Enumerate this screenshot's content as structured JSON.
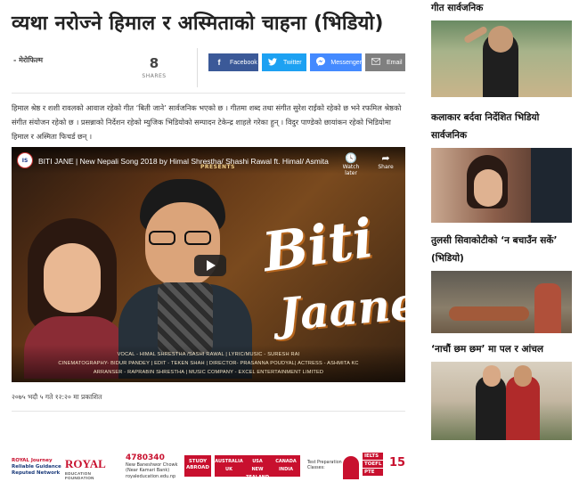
{
  "article": {
    "title": "व्यथा नरोज्ने हिमाल र अस्मिताको चाहना (भिडियो)",
    "author": "- मेरोफिल्म",
    "shares_count": "8",
    "shares_label": "SHARES",
    "share_buttons": {
      "facebook": "Facebook",
      "twitter": "Twitter",
      "messenger": "Messenger",
      "email": "Email"
    },
    "body": "हिमाल श्रेष्ठ र शशी रावलको आवाज रहेको गीत ‘बिती जाने’ सार्वजनिक भएको छ । गीतमा शब्द तथा संगीत सुरेश राईको रहेको छ भने रफमिल श्रेष्ठको संगीत संयोजन रहेको छ । प्रसन्नाको निर्देशन रहेको म्युजिक भिडियोको सम्पादन टेकेन्द्र शाहले गरेका हुन् । विदुर पाण्डेको छायांकन रहेको भिडियोमा हिमाल र अस्मिता फिचर्ड छन् ।",
    "published": "२०७५ भदौ ५ गते १२:२० मा प्रकाशित"
  },
  "video": {
    "channel_logo": "IS",
    "title": "BITI JANE | New Nepali Song 2018 by Himal Shrestha/ Shashi Rawal ft. Himal/ Asmita",
    "presents": "PRESENTS",
    "watch_later": "Watch later",
    "share": "Share",
    "art_word_1": "Biti",
    "art_word_2": "Jaane",
    "credits": [
      "VOCAL - HIMAL SHRESTHA /SASHI RAWAL | LYRIC/MUSIC - SURESH RAI",
      "CINEMATOGRAPHY- BIDUR PANDEY | EDIT - TEKEN SHAH | DIRECTOR- PRASANNA POUDYAL| ACTRESS - ASHMITA KC",
      "ARRANSER - RAPRABIN SHRESTHA | MUSIC COMPANY - EXCEL ENTERTAINMENT LIMITED"
    ]
  },
  "ad": {
    "r1_line1": "ROYAL Journey",
    "r1_line2": "Reliable Guidance",
    "r1_line3": "Reputed Network",
    "r2_brand": "ROYAL",
    "r2_sub": "EDUCATION FOUNDATION",
    "r3_phone": "4780340",
    "r3_line1": "New Baneshwor Chowk",
    "r3_line2": "(Near Kamari Bank)",
    "r3_site": "royaleducation.edu.np",
    "r4_text": "STUDY ABROAD",
    "r5_countries": [
      "AUSTRALIA",
      "USA",
      "CANADA",
      "UK",
      "NEW ZEALAND",
      "INDIA"
    ],
    "r6_text": "Test Preparation Classes:",
    "r7_tags": [
      "IELTS",
      "TOEFL",
      "PTE"
    ],
    "r8_text": "15"
  },
  "sidebar": {
    "items": [
      {
        "title": "गीत सार्वजनिक"
      },
      {
        "title": "कलाकार बर्दवा निर्देशित भिडियो सार्वजनिक"
      },
      {
        "title": "तुलसी सिवाकोटीको ‘न बचाउँन सकें’ (भिडियो)"
      },
      {
        "title": "‘नाचौं छम छम’ मा पल र आंचल"
      }
    ]
  }
}
